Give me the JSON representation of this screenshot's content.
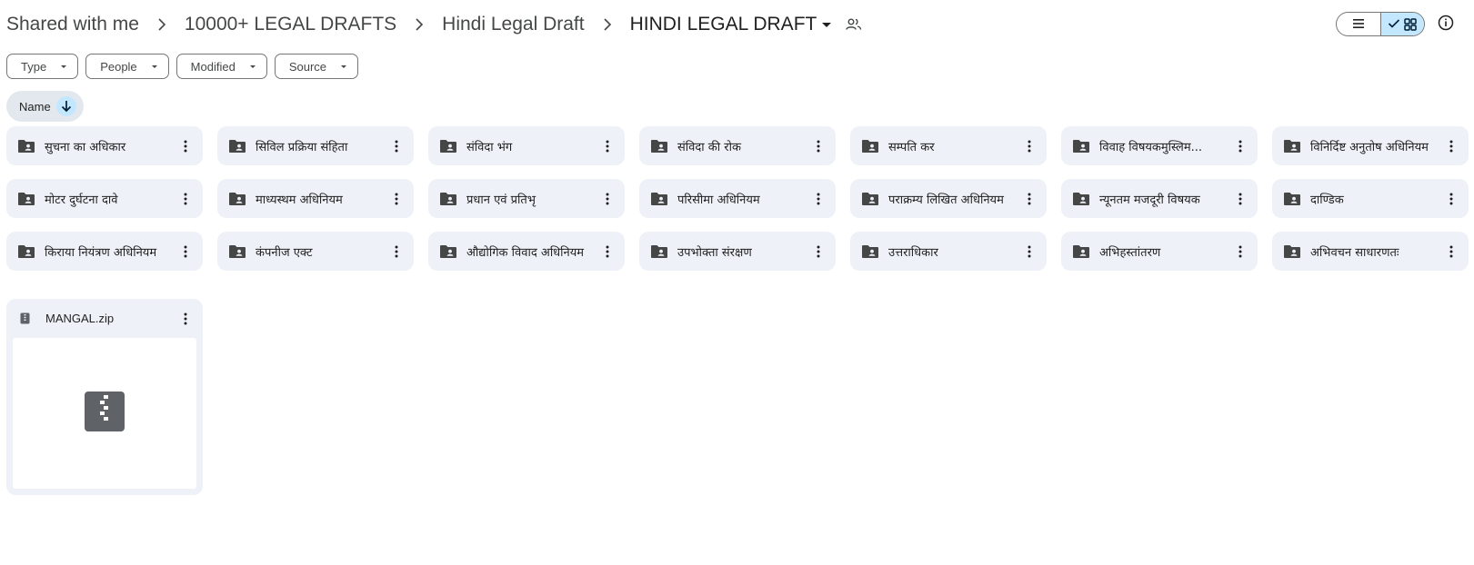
{
  "breadcrumb": {
    "items": [
      "Shared with me",
      "10000+ LEGAL DRAFTS",
      "Hindi Legal Draft"
    ],
    "current": "HINDI LEGAL DRAFT"
  },
  "filters": [
    "Type",
    "People",
    "Modified",
    "Source"
  ],
  "sort": {
    "label": "Name",
    "direction": "descending"
  },
  "view": {
    "mode": "grid"
  },
  "icons": {
    "folder": "shared-folder-icon",
    "more": "more-vert-icon",
    "zip": "zip-file-icon",
    "list_view": "list-view-icon",
    "grid_view": "grid-view-icon",
    "info": "info-icon"
  },
  "colors": {
    "card_bg": "#eef2f8",
    "accent_bg": "#c2e7ff",
    "icon": "#444746"
  },
  "folders": [
    "सुचना का अधिकार",
    "सिविल प्रक्रिया संहिता",
    "संविदा भंग",
    "संविदा की रोक",
    "सम्पति कर",
    "विवाह विषयकमुस्लिम...",
    "विनिर्दिष्ट अनुतोष अधिनियम",
    "मोटर दुर्घटना दावे",
    "माध्यस्थम अधिनियम",
    "प्रधान एवं प्रतिभृ",
    "परिसीमा अधिनियम",
    "पराक्रम्य लिखित अधिनियम",
    "न्यूनतम मजदूरी विषयक",
    "दाण्डिक",
    "किराया नियंत्रण अधिनियम",
    "कंपनीज एक्ट",
    "औद्योगिक विवाद अधिनियम",
    "उपभोक्ता संरक्षण",
    "उत्तराधिकार",
    "अभिहस्तांतरण",
    "अभिवचन साधारणतः"
  ],
  "files": [
    {
      "name": "MANGAL.zip"
    }
  ]
}
